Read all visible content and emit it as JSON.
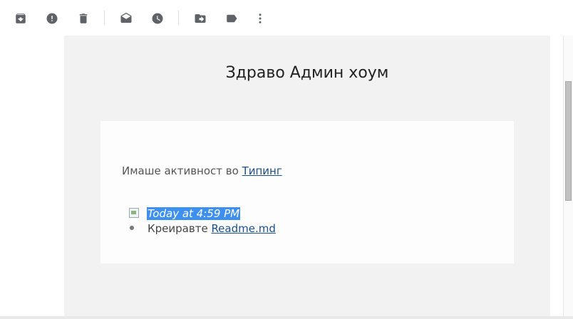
{
  "toolbar": {
    "buttons": [
      {
        "icon": "archive-icon"
      },
      {
        "icon": "report-spam-icon"
      },
      {
        "icon": "delete-icon"
      },
      {
        "icon": "mark-unread-icon"
      },
      {
        "icon": "snooze-icon"
      },
      {
        "icon": "move-to-icon"
      },
      {
        "icon": "label-icon"
      },
      {
        "icon": "more-options-icon"
      }
    ]
  },
  "email": {
    "greeting": "Здраво Админ хоум",
    "activity_prefix": "Имаше активност во ",
    "activity_link": "Типинг",
    "items": [
      {
        "timestamp": "Today at 4:59 PM"
      },
      {
        "action": "Креиравте ",
        "link": "Readme.md"
      }
    ]
  },
  "colors": {
    "selection": "#3d8ff0",
    "link": "#1a4f8b",
    "mail_background": "#f2f2f2"
  }
}
